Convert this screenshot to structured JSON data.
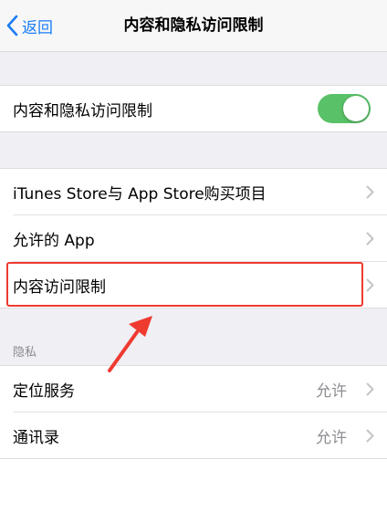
{
  "navbar": {
    "back_label": "返回",
    "title": "内容和隐私访问限制"
  },
  "toggle_row": {
    "label": "内容和隐私访问限制",
    "toggle_on": true,
    "toggle_color": "#59c167"
  },
  "store_section": {
    "items": [
      {
        "label": "iTunes Store与 App Store购买项目"
      },
      {
        "label": "允许的 App"
      },
      {
        "label": "内容访问限制"
      }
    ]
  },
  "privacy_section": {
    "header": "隐私",
    "items": [
      {
        "label": "定位服务",
        "value": "允许"
      },
      {
        "label": "通讯录",
        "value": "允许"
      }
    ]
  },
  "annotation": {
    "highlight_color": "#ef3a30",
    "arrow_icon": "red-arrow-icon"
  }
}
